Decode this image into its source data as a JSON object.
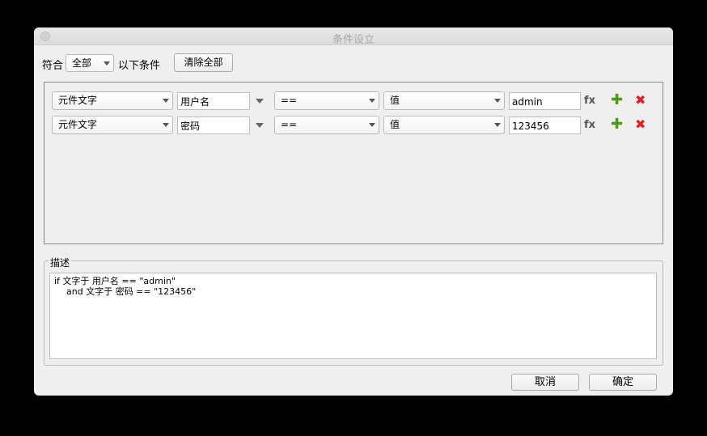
{
  "window": {
    "title": "条件设立"
  },
  "header": {
    "match_label": "符合",
    "match_value": "全部",
    "condition_label": "以下条件",
    "clear_all_label": "清除全部"
  },
  "rows": [
    {
      "target_type": "元件文字",
      "target": "用户名",
      "operator": "==",
      "value_type": "值",
      "value": "admin",
      "fx": "fx"
    },
    {
      "target_type": "元件文字",
      "target": "密码",
      "operator": "==",
      "value_type": "值",
      "value": "123456",
      "fx": "fx"
    }
  ],
  "row_icons": {
    "add": "plus-icon",
    "delete": "close-icon"
  },
  "description": {
    "title": "描述",
    "line1": "if 文字于 用户名 == \"admin\"",
    "line2": "and 文字于 密码 == \"123456\""
  },
  "footer": {
    "cancel_label": "取消",
    "ok_label": "确定"
  },
  "colors": {
    "add": "#4c9a1e",
    "delete": "#e02020",
    "panel_bg": "#efefef"
  }
}
